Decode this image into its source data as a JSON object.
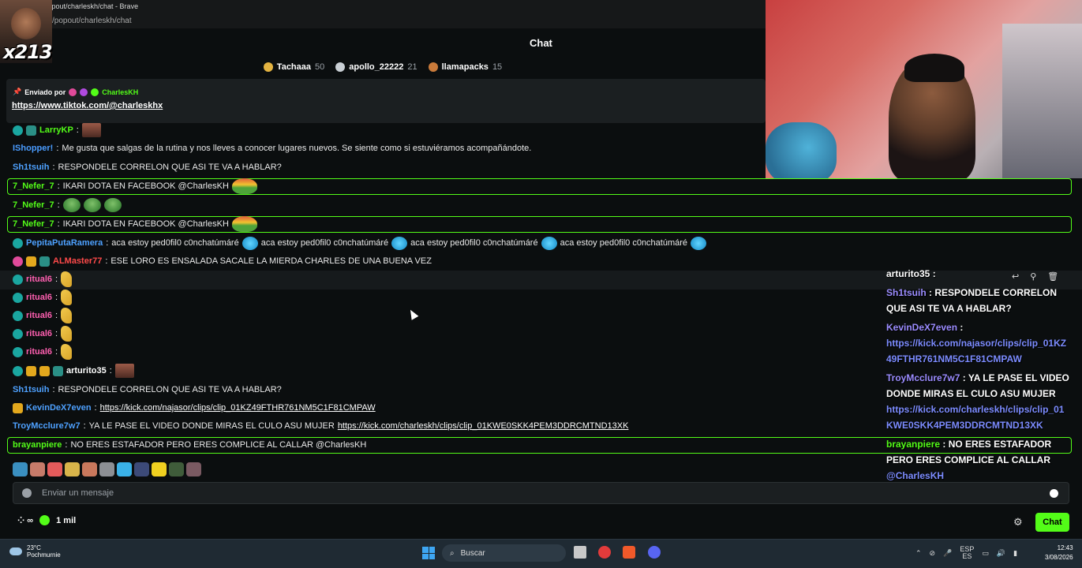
{
  "browser": {
    "window_title": "kick.com/popout/charleskh/chat - Brave",
    "url": "/popout/charleskh/chat"
  },
  "overlay": {
    "tag": "x213"
  },
  "chat": {
    "title": "Chat",
    "top_gifters": [
      {
        "name": "Tachaaa",
        "count": "50",
        "color": "#e3b341"
      },
      {
        "name": "apollo_22222",
        "count": "21",
        "color": "#c9cfd4"
      },
      {
        "name": "llamapacks",
        "count": "15",
        "color": "#c97a3a"
      }
    ],
    "pinned": {
      "by_label": "Enviado por",
      "by_user": "CharlesKH",
      "link": "https://www.tiktok.com/@charleskhx"
    },
    "messages": [
      {
        "name": "LarryKP",
        "name_color": "#53fc18",
        "sep": ":",
        "text": ""
      },
      {
        "name": "IShopper!",
        "name_color": "#4a9cff",
        "sep": ":",
        "text": "Me gusta que salgas de la rutina y nos lleves a conocer lugares nuevos. Se siente como si estuviéramos acompañándote."
      },
      {
        "name": "Sh1tsuih",
        "name_color": "#4ea1ff",
        "sep": ":",
        "text": "RESPONDELE CORRELON QUE ASI TE VA A HABLAR?"
      },
      {
        "name": "7_Nefer_7",
        "name_color": "#53fc18",
        "sep": ":",
        "text": "IKARI DOTA EN FACEBOOK @CharlesKH"
      },
      {
        "name": "7_Nefer_7",
        "name_color": "#53fc18",
        "sep": ":",
        "text": ""
      },
      {
        "name": "7_Nefer_7",
        "name_color": "#53fc18",
        "sep": ":",
        "text": "IKARI DOTA EN FACEBOOK @CharlesKH"
      },
      {
        "name": "PepitaPutaRamera",
        "name_color": "#4ea1ff",
        "sep": ":",
        "text": "aca estoy ped0fil0 c0nchatúmáré",
        "repeat_text": [
          "aca estoy ped0fil0 c0nchatúmáré",
          "aca estoy ped0fil0 c0nchatúmáré",
          "aca estoy ped0fil0 c0nchatúmáré"
        ]
      },
      {
        "name": "ALMaster77",
        "name_color": "#ff4a4a",
        "sep": ":",
        "text": "ESE LORO ES ENSALADA SACALE LA MIERDA CHARLES DE UNA BUENA VEZ"
      },
      {
        "name": "ritual6",
        "name_color": "#ff5fb0",
        "sep": ":",
        "text": ""
      },
      {
        "name": "ritual6",
        "name_color": "#ff5fb0",
        "sep": ":",
        "text": ""
      },
      {
        "name": "ritual6",
        "name_color": "#ff5fb0",
        "sep": ":",
        "text": ""
      },
      {
        "name": "ritual6",
        "name_color": "#ff5fb0",
        "sep": ":",
        "text": ""
      },
      {
        "name": "ritual6",
        "name_color": "#ff5fb0",
        "sep": ":",
        "text": ""
      },
      {
        "name": "arturito35",
        "name_color": "#ffffff",
        "sep": ":",
        "text": ""
      },
      {
        "name": "Sh1tsuih",
        "name_color": "#4ea1ff",
        "sep": ":",
        "text": "RESPONDELE CORRELON QUE ASI TE VA A HABLAR?"
      },
      {
        "name": "KevinDeX7even",
        "name_color": "#4ea1ff",
        "sep": ":",
        "text": "",
        "link": "https://kick.com/najasor/clips/clip_01KZ49FTHR761NM5C1F81CMPAW"
      },
      {
        "name": "TroyMcclure7w7",
        "name_color": "#4ea1ff",
        "sep": ":",
        "text": "YA LE PASE EL VIDEO DONDE MIRAS EL CULO ASU MUJER",
        "link": "https://kick.com/charleskh/clips/clip_01KWE0SKK4PEM3DDRCMTND13XK"
      },
      {
        "name": "brayanpiere",
        "name_color": "#53fc18",
        "sep": ":",
        "text": "NO ERES ESTAFADOR PERO ERES COMPLICE AL CALLAR @CharlesKH"
      }
    ],
    "input_placeholder": "Enviar un mensaje",
    "viewers": "1 mil",
    "chat_button": "Chat"
  },
  "stream_overlay_chat": {
    "lines": [
      {
        "name": "arturito35",
        "text": ""
      },
      {
        "name": "Sh1tsuih",
        "text": "RESPONDELE CORRELON"
      },
      {
        "name": "",
        "text": "QUE ASI TE VA A HABLAR?"
      },
      {
        "name": "KevinDeX7even",
        "text": ""
      },
      {
        "name": "",
        "text": "https://kick.com/najasor/clips/clip_01KZ"
      },
      {
        "name": "",
        "text": "49FTHR761NM5C1F81CMPAW"
      },
      {
        "name": "TroyMcclure7w7",
        "text": "YA LE PASE EL VIDEO"
      },
      {
        "name": "",
        "text": "DONDE MIRAS EL CULO ASU MUJER"
      },
      {
        "name": "",
        "text": "https://kick.com/charleskh/clips/clip_01"
      },
      {
        "name": "",
        "text": "KWE0SKK4PEM3DDRCMTND13XK"
      },
      {
        "name": "brayanpiere",
        "text": "NO ERES ESTAFADOR"
      },
      {
        "name": "",
        "text": "PERO ERES COMPLICE AL CALLAR"
      },
      {
        "name": "",
        "text": "@CharlesKH"
      }
    ]
  },
  "taskbar": {
    "temperature": "23°C",
    "weather": "Pochmurnie",
    "search": "Buscar",
    "lang_top": "ESP",
    "lang_bottom": "ES",
    "time": "12:43",
    "date": "3/08/2026"
  }
}
